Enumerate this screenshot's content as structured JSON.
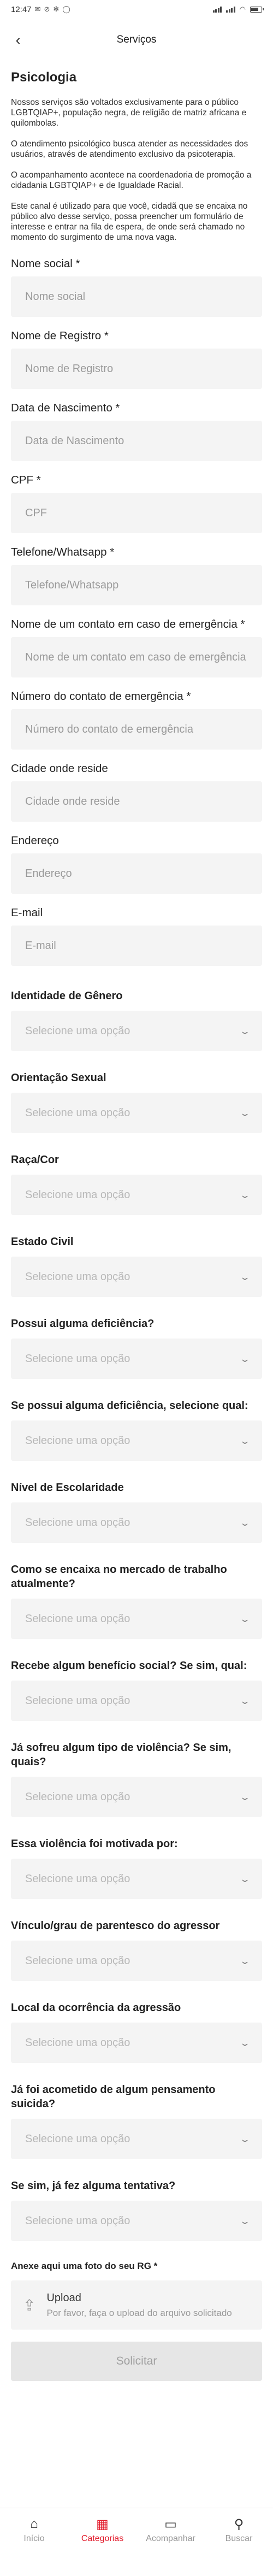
{
  "status": {
    "time": "12:47"
  },
  "header": {
    "title": "Serviços"
  },
  "page": {
    "title": "Psicologia",
    "paragraphs": [
      "Nossos serviços são voltados exclusivamente para o público LGBTQIAP+, população negra, de religião de matriz africana e quilombolas.",
      "O atendimento psicológico busca atender as necessidades dos usuários, através de atendimento exclusivo da psicoterapia.",
      "O acompanhamento acontece na coordenadoria de promoção a cidadania LGBTQIAP+ e de Igualdade Racial.",
      "Este canal é utilizado para que você, cidadã que se encaixa no público alvo desse serviço, possa preencher um formulário de interesse e entrar na fila de espera, de onde será chamado no momento do surgimento de uma nova vaga."
    ]
  },
  "inputs": [
    {
      "label": "Nome social *",
      "placeholder": "Nome social"
    },
    {
      "label": "Nome de Registro *",
      "placeholder": "Nome de Registro"
    },
    {
      "label": "Data de Nascimento *",
      "placeholder": "Data de Nascimento"
    },
    {
      "label": "CPF *",
      "placeholder": "CPF"
    },
    {
      "label": "Telefone/Whatsapp *",
      "placeholder": "Telefone/Whatsapp"
    },
    {
      "label": "Nome de um contato em caso de emergência *",
      "placeholder": "Nome de um contato em caso de emergência"
    },
    {
      "label": "Número do contato de emergência *",
      "placeholder": "Número do contato de emergência"
    },
    {
      "label": "Cidade onde reside",
      "placeholder": "Cidade onde reside"
    },
    {
      "label": "Endereço",
      "placeholder": "Endereço"
    },
    {
      "label": "E-mail",
      "placeholder": "E-mail"
    }
  ],
  "selects": [
    {
      "label": "Identidade de Gênero",
      "value": "Selecione uma opção"
    },
    {
      "label": "Orientação Sexual",
      "value": "Selecione uma opção"
    },
    {
      "label": "Raça/Cor",
      "value": "Selecione uma opção"
    },
    {
      "label": "Estado Civil",
      "value": "Selecione uma opção"
    },
    {
      "label": "Possui alguma deficiência?",
      "value": "Selecione uma opção"
    },
    {
      "label": "Se possui alguma deficiência, selecione qual:",
      "value": "Selecione uma opção"
    },
    {
      "label": "Nível de Escolaridade",
      "value": "Selecione uma opção"
    },
    {
      "label": "Como se encaixa no mercado de trabalho atualmente?",
      "value": "Selecione uma opção"
    },
    {
      "label": "Recebe algum benefício social? Se sim, qual:",
      "value": "Selecione uma opção"
    },
    {
      "label": "Já sofreu algum tipo de violência? Se sim, quais?",
      "value": "Selecione uma opção"
    },
    {
      "label": "Essa violência foi motivada por:",
      "value": "Selecione uma opção"
    },
    {
      "label": "Vínculo/grau de parentesco do agressor",
      "value": "Selecione uma opção"
    },
    {
      "label": "Local da ocorrência da agressão",
      "value": "Selecione uma opção"
    },
    {
      "label": "Já foi acometido de algum pensamento suicida?",
      "value": "Selecione uma opção"
    },
    {
      "label": "Se sim, já fez alguma tentativa?",
      "value": "Selecione uma opção"
    }
  ],
  "upload": {
    "label": "Anexe aqui uma foto do seu RG *",
    "title": "Upload",
    "subtitle": "Por favor, faça o upload do arquivo solicitado"
  },
  "submit_label": "Solicitar",
  "tabs": [
    {
      "label": "Início",
      "icon": "home-icon"
    },
    {
      "label": "Categorias",
      "icon": "grid-icon"
    },
    {
      "label": "Acompanhar",
      "icon": "folder-icon"
    },
    {
      "label": "Buscar",
      "icon": "search-icon"
    }
  ],
  "colors": {
    "accent": "#e21b2b",
    "field_bg": "#f4f4f4",
    "button_bg": "#e6e6e6"
  }
}
